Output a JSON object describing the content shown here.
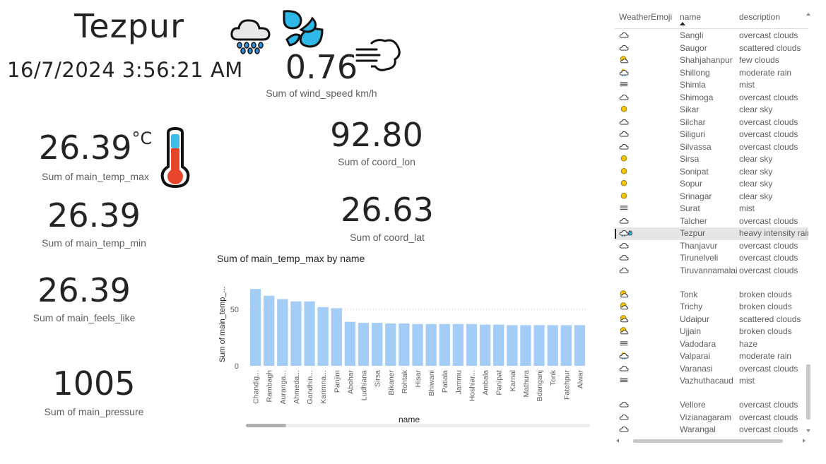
{
  "header": {
    "city": "Tezpur",
    "datetime": "16/7/2024 3:56:21 AM"
  },
  "kpis": {
    "wind_speed": {
      "value": "0.76",
      "label": "Sum of wind_speed km/h"
    },
    "temp_max": {
      "value": "26.39",
      "unit": "°C",
      "label": "Sum of main_temp_max"
    },
    "coord_lon": {
      "value": "92.80",
      "label": "Sum of coord_lon"
    },
    "temp_min": {
      "value": "26.39",
      "label": "Sum of main_temp_min"
    },
    "coord_lat": {
      "value": "26.63",
      "label": "Sum of coord_lat"
    },
    "feels_like": {
      "value": "26.39",
      "label": "Sum of main_feels_like"
    },
    "pressure": {
      "value": "1005",
      "label": "Sum of main_pressure"
    }
  },
  "chart_data": {
    "type": "bar",
    "title": "Sum of main_temp_max by name",
    "xlabel": "name",
    "ylabel": "Sum of main_temp_...",
    "ylim": [
      0,
      70
    ],
    "yticks": [
      "0",
      "50"
    ],
    "bar_color": "#a3cdf7",
    "grid": "dotted horizontal",
    "categories": [
      "Chandig...",
      "Rambagh",
      "Auranga...",
      "Ahmeda...",
      "Gandhin...",
      "Karimna...",
      "Panjim",
      "Abohar",
      "Ludhiana",
      "Sirsa",
      "Bikaner",
      "Rohtak",
      "Hisar",
      "Bhiwani",
      "Patiala",
      "Jammu",
      "Hoshiar...",
      "Ambala",
      "Panipat",
      "Karnal",
      "Mathura",
      "Bdanganj",
      "Tonk",
      "Fatehpur",
      "Alwar"
    ],
    "values": [
      68,
      62,
      59,
      57,
      57,
      52,
      51,
      39,
      38,
      38,
      37.5,
      37.5,
      37,
      37,
      37,
      37,
      37,
      36.5,
      36.5,
      36,
      36,
      36,
      36,
      36,
      36
    ]
  },
  "table": {
    "columns": [
      "WeatherEmoji",
      "name",
      "description"
    ],
    "rows": [
      {
        "icon": "cloud-icon",
        "name": "Sangli",
        "description": "overcast clouds"
      },
      {
        "icon": "cloud-icon",
        "name": "Saugor",
        "description": "scattered clouds"
      },
      {
        "icon": "sun-cloud-icon",
        "name": "Shahjahanpur",
        "description": "few clouds"
      },
      {
        "icon": "rain-cloud-icon",
        "name": "Shillong",
        "description": "moderate rain"
      },
      {
        "icon": "fog-icon",
        "name": "Shimla",
        "description": "mist"
      },
      {
        "icon": "cloud-icon",
        "name": "Shimoga",
        "description": "overcast clouds"
      },
      {
        "icon": "sun-icon",
        "name": "Sikar",
        "description": "clear sky"
      },
      {
        "icon": "cloud-icon",
        "name": "Silchar",
        "description": "overcast clouds"
      },
      {
        "icon": "cloud-icon",
        "name": "Siliguri",
        "description": "overcast clouds"
      },
      {
        "icon": "cloud-icon",
        "name": "Silvassa",
        "description": "overcast clouds"
      },
      {
        "icon": "sun-icon",
        "name": "Sirsa",
        "description": "clear sky"
      },
      {
        "icon": "sun-icon",
        "name": "Sonipat",
        "description": "clear sky"
      },
      {
        "icon": "sun-icon",
        "name": "Sopur",
        "description": "clear sky"
      },
      {
        "icon": "sun-icon",
        "name": "Srinagar",
        "description": "clear sky"
      },
      {
        "icon": "fog-icon",
        "name": "Surat",
        "description": "mist"
      },
      {
        "icon": "cloud-icon",
        "name": "Talcher",
        "description": "overcast clouds"
      },
      {
        "icon": "rain-drops-icon",
        "name": "Tezpur",
        "description": "heavy intensity rain",
        "selected": true
      },
      {
        "icon": "cloud-icon",
        "name": "Thanjavur",
        "description": "overcast clouds"
      },
      {
        "icon": "cloud-icon",
        "name": "Tirunelveli",
        "description": "overcast clouds"
      },
      {
        "icon": "cloud-icon",
        "name": "Tiruvannamalai",
        "description": "overcast clouds",
        "tall": true
      },
      {
        "icon": "sun-cloud-icon",
        "name": "Tonk",
        "description": "broken clouds"
      },
      {
        "icon": "sun-cloud-icon",
        "name": "Trichy",
        "description": "broken clouds"
      },
      {
        "icon": "sun-cloud-icon",
        "name": "Udaipur",
        "description": "scattered clouds"
      },
      {
        "icon": "sun-cloud-icon",
        "name": "Ujjain",
        "description": "broken clouds"
      },
      {
        "icon": "fog-icon",
        "name": "Vadodara",
        "description": "haze"
      },
      {
        "icon": "rain-cloud-icon",
        "name": "Valparai",
        "description": "moderate rain"
      },
      {
        "icon": "cloud-icon",
        "name": "Varanasi",
        "description": "overcast clouds"
      },
      {
        "icon": "fog-icon",
        "name": "Vazhuthacaud",
        "description": "mist",
        "tall": true
      },
      {
        "icon": "cloud-icon",
        "name": "Vellore",
        "description": "overcast clouds"
      },
      {
        "icon": "cloud-icon",
        "name": "Vizianagaram",
        "description": "overcast clouds"
      },
      {
        "icon": "cloud-icon",
        "name": "Warangal",
        "description": "overcast clouds"
      }
    ]
  }
}
